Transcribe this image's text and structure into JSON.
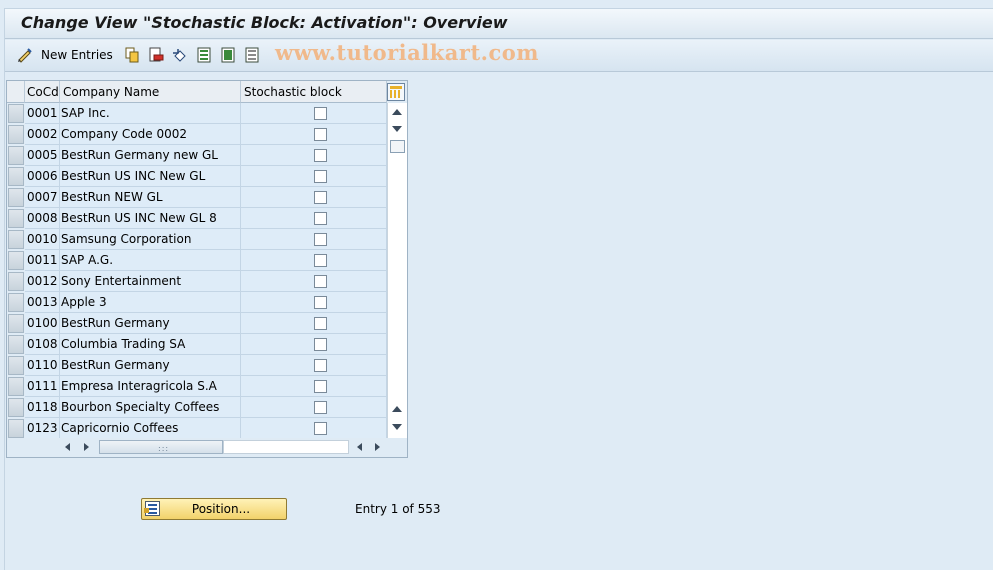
{
  "window": {
    "title": "Change View \"Stochastic Block: Activation\": Overview"
  },
  "toolbar": {
    "new_entries_label": "New Entries",
    "watermark": "www.tutorialkart.com",
    "icons": [
      "edit-pencil-icon",
      "copy-icon",
      "delete-icon",
      "undo-icon",
      "select-all-icon",
      "select-block-icon",
      "deselect-all-icon"
    ]
  },
  "table": {
    "columns": {
      "cocd": "CoCd",
      "name": "Company Name",
      "block": "Stochastic block"
    },
    "rows": [
      {
        "cocd": "0001",
        "name": "SAP Inc.",
        "checked": false
      },
      {
        "cocd": "0002",
        "name": "Company Code 0002",
        "checked": false
      },
      {
        "cocd": "0005",
        "name": "BestRun Germany new GL",
        "checked": false
      },
      {
        "cocd": "0006",
        "name": "BestRun US INC New GL",
        "checked": false
      },
      {
        "cocd": "0007",
        "name": "BestRun NEW GL",
        "checked": false
      },
      {
        "cocd": "0008",
        "name": "BestRun US INC New GL 8",
        "checked": false
      },
      {
        "cocd": "0010",
        "name": "Samsung Corporation",
        "checked": false
      },
      {
        "cocd": "0011",
        "name": "SAP A.G.",
        "checked": false
      },
      {
        "cocd": "0012",
        "name": "Sony Entertainment",
        "checked": false
      },
      {
        "cocd": "0013",
        "name": "Apple 3",
        "checked": false
      },
      {
        "cocd": "0100",
        "name": "BestRun Germany",
        "checked": false
      },
      {
        "cocd": "0108",
        "name": "Columbia Trading SA",
        "checked": false
      },
      {
        "cocd": "0110",
        "name": "BestRun Germany",
        "checked": false
      },
      {
        "cocd": "0111",
        "name": "Empresa Interagricola S.A",
        "checked": false
      },
      {
        "cocd": "0118",
        "name": "Bourbon Specialty Coffees",
        "checked": false
      },
      {
        "cocd": "0123",
        "name": "Capricornio Coffees",
        "checked": false
      }
    ]
  },
  "footer": {
    "position_label": "Position...",
    "entry_text": "Entry 1 of 553"
  }
}
